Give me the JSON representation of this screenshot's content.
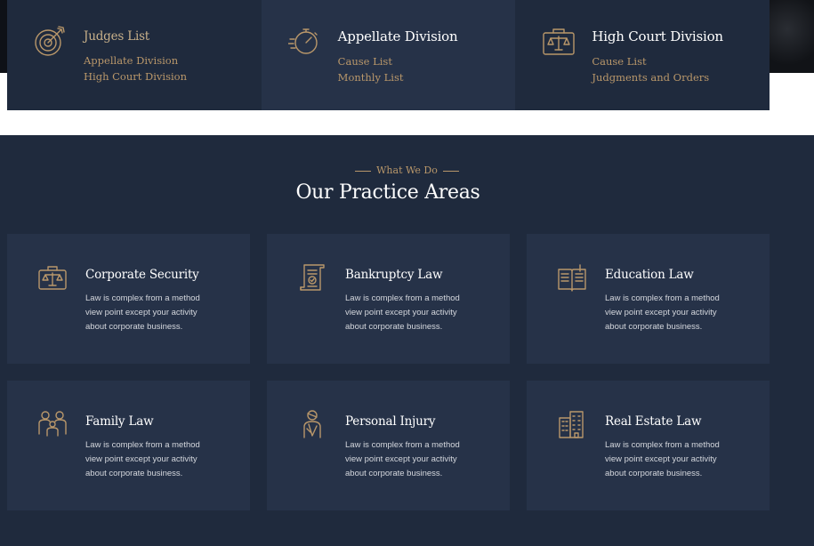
{
  "quick_links": [
    {
      "title": "Judges List",
      "links": [
        "Appellate Division",
        "High Court Division"
      ],
      "icon": "target-icon"
    },
    {
      "title": "Appellate Division",
      "links": [
        "Cause List",
        "Monthly List"
      ],
      "icon": "stopwatch-icon"
    },
    {
      "title": "High Court Division",
      "links": [
        "Cause List",
        "Judgments and Orders"
      ],
      "icon": "briefcase-scale-icon"
    }
  ],
  "practice": {
    "eyebrow": "What We Do",
    "title": "Our Practice Areas",
    "cards": [
      {
        "title": "Corporate Security",
        "text": "Law is complex from a method view point except your activity about corporate business.",
        "icon": "briefcase-scale-icon"
      },
      {
        "title": "Bankruptcy Law",
        "text": "Law is complex from a method view point except your activity about corporate business.",
        "icon": "scroll-icon"
      },
      {
        "title": "Education Law",
        "text": "Law is complex from a method view point except your activity about corporate business.",
        "icon": "book-icon"
      },
      {
        "title": "Family Law",
        "text": "Law is complex from a method view point except your activity about corporate business.",
        "icon": "family-icon"
      },
      {
        "title": "Personal Injury",
        "text": "Law is complex from a method view point except your activity about corporate business.",
        "icon": "injured-person-icon"
      },
      {
        "title": "Real Estate Law",
        "text": "Law is complex from a method view point except your activity about corporate business.",
        "icon": "building-icon"
      }
    ]
  },
  "colors": {
    "navy": "#1f2a3d",
    "navy_light": "#263248",
    "gold": "#b9976a"
  }
}
